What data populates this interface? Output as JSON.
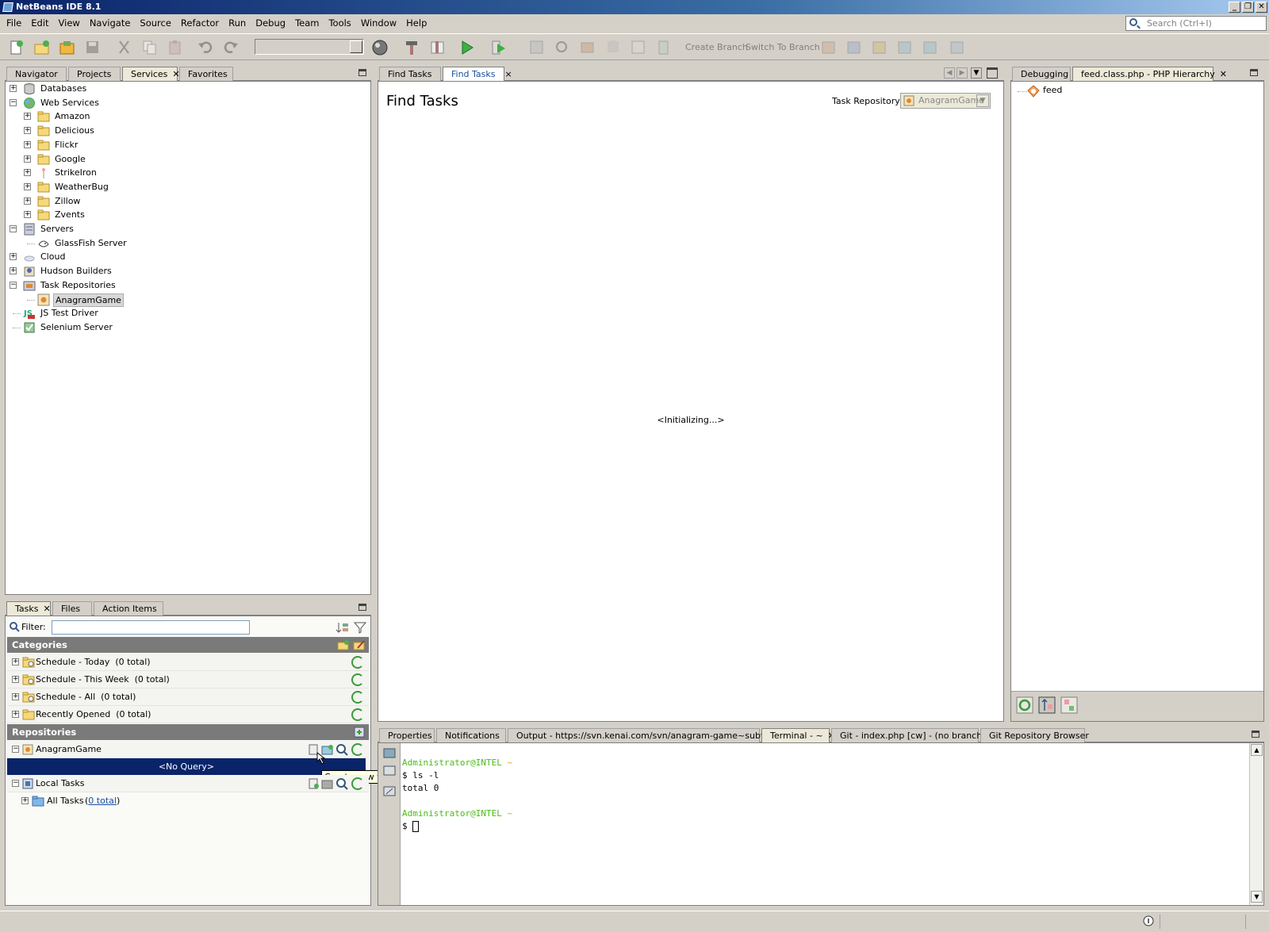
{
  "app": {
    "title": "NetBeans IDE 8.1"
  },
  "menu": [
    "File",
    "Edit",
    "View",
    "Navigate",
    "Source",
    "Refactor",
    "Run",
    "Debug",
    "Team",
    "Tools",
    "Window",
    "Help"
  ],
  "search": {
    "placeholder": "Search (Ctrl+I)"
  },
  "toolbar": {
    "create_branch": "Create Branch",
    "switch_branch": "Switch To Branch"
  },
  "left_tabs": [
    "Navigator",
    "Projects",
    "Services",
    "Favorites"
  ],
  "services_tree": [
    {
      "label": "Databases",
      "level": 0,
      "exp": "+",
      "icon": "database-icon"
    },
    {
      "label": "Web Services",
      "level": 0,
      "exp": "-",
      "icon": "globe-icon"
    },
    {
      "label": "Amazon",
      "level": 1,
      "exp": "+",
      "icon": "folder-icon"
    },
    {
      "label": "Delicious",
      "level": 1,
      "exp": "+",
      "icon": "folder-icon"
    },
    {
      "label": "Flickr",
      "level": 1,
      "exp": "+",
      "icon": "folder-icon"
    },
    {
      "label": "Google",
      "level": 1,
      "exp": "+",
      "icon": "folder-icon"
    },
    {
      "label": "StrikeIron",
      "level": 1,
      "exp": "+",
      "icon": "pin-icon"
    },
    {
      "label": "WeatherBug",
      "level": 1,
      "exp": "+",
      "icon": "folder-icon"
    },
    {
      "label": "Zillow",
      "level": 1,
      "exp": "+",
      "icon": "folder-icon"
    },
    {
      "label": "Zvents",
      "level": 1,
      "exp": "+",
      "icon": "folder-icon"
    },
    {
      "label": "Servers",
      "level": 0,
      "exp": "-",
      "icon": "server-icon"
    },
    {
      "label": "GlassFish Server",
      "level": 1,
      "exp": "",
      "icon": "glassfish-icon"
    },
    {
      "label": "Cloud",
      "level": 0,
      "exp": "+",
      "icon": "cloud-icon"
    },
    {
      "label": "Hudson Builders",
      "level": 0,
      "exp": "+",
      "icon": "hudson-icon"
    },
    {
      "label": "Task Repositories",
      "level": 0,
      "exp": "-",
      "icon": "repository-icon"
    },
    {
      "label": "AnagramGame",
      "level": 1,
      "exp": "",
      "icon": "task-repo-icon",
      "selected": true
    },
    {
      "label": "JS Test Driver",
      "level": 0,
      "exp": "",
      "icon": "js-icon"
    },
    {
      "label": "Selenium Server",
      "level": 0,
      "exp": "",
      "icon": "selenium-icon"
    }
  ],
  "editor_tabs": [
    "Find Tasks",
    "Find Tasks"
  ],
  "find_tasks": {
    "heading": "Find Tasks",
    "repo_label": "Task Repository:",
    "repo_value": "AnagramGame",
    "status": "<Initializing...>"
  },
  "right_tabs": [
    "Debugging",
    "feed.class.php - PHP Hierarchy"
  ],
  "hierarchy": {
    "node": "feed"
  },
  "tasks_tabs": [
    "Tasks",
    "Files",
    "Action Items"
  ],
  "filter": {
    "label": "Filter:",
    "value": ""
  },
  "categories": {
    "header": "Categories",
    "rows": [
      "Schedule - Today  (0 total)",
      "Schedule - This Week  (0 total)",
      "Schedule - All  (0 total)",
      "Recently Opened  (0 total)"
    ]
  },
  "repositories": {
    "header": "Repositories",
    "anagram": "AnagramGame",
    "no_query": "<No Query>",
    "local": "Local Tasks",
    "all_tasks": "All Tasks",
    "all_total": "0 total",
    "tooltip": "Create new task"
  },
  "bottom_tabs": [
    "Properties",
    "Notifications",
    "Output - https://svn.kenai.com/svn/anagram-game~subversion",
    "Terminal - ~",
    "Git - index.php [cw] - (no branch)",
    "Git Repository Browser"
  ],
  "terminal": {
    "prompt1": "Administrator@INTEL",
    "tilde1": "~",
    "cmd": "$ ls -l",
    "out": "total 0",
    "prompt2": "Administrator@INTEL",
    "tilde2": "~",
    "cursor_line": "$"
  },
  "colors": {
    "selection": "#0a246a",
    "title_start": "#0a246a",
    "section_header": "#7a7a7a"
  }
}
